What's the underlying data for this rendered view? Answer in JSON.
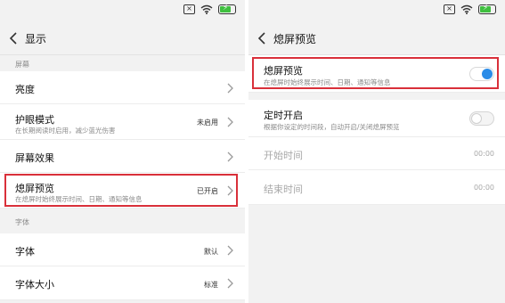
{
  "left": {
    "title": "显示",
    "sections": {
      "screen": "屏幕",
      "font": "字体"
    },
    "items": [
      {
        "label": "亮度",
        "sub": "",
        "value": ""
      },
      {
        "label": "护眼模式",
        "sub": "在长期阅读时启用，减少蓝光伤害",
        "value": "未启用"
      },
      {
        "label": "屏幕效果",
        "sub": "",
        "value": ""
      },
      {
        "label": "熄屏预览",
        "sub": "在熄屏时始终展示时间、日期、通知等信息",
        "value": "已开启"
      },
      {
        "label": "字体",
        "sub": "",
        "value": "默认"
      },
      {
        "label": "字体大小",
        "sub": "",
        "value": "标准"
      }
    ]
  },
  "right": {
    "title": "熄屏预览",
    "items": [
      {
        "label": "熄屏预览",
        "sub": "在熄屏时始终展示时间、日期、通知等信息",
        "toggle": true
      },
      {
        "label": "定时开启",
        "sub": "根据你设定的时间段，自动开启/关闭熄屏预览",
        "toggle": false
      },
      {
        "label": "开始时间",
        "value": "00:00"
      },
      {
        "label": "结束时间",
        "value": "00:00"
      }
    ]
  },
  "colors": {
    "highlight": "#d9303a",
    "toggle_on": "#2b8ce8",
    "battery": "#3fbf3f"
  },
  "icons": [
    "close-box-icon",
    "wifi-icon",
    "battery-icon",
    "back-arrow-icon",
    "chevron-right-icon"
  ]
}
